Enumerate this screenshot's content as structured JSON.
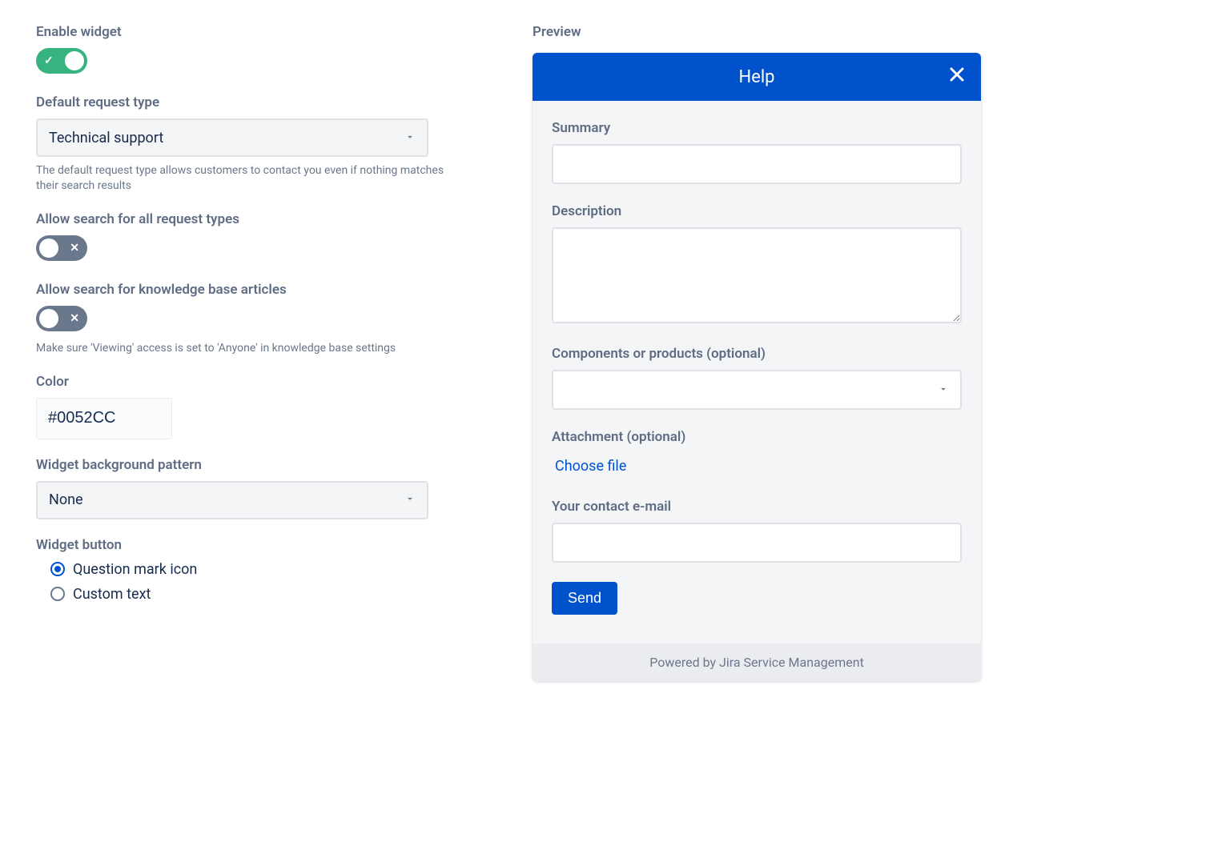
{
  "settings": {
    "enable_label": "Enable widget",
    "default_request": {
      "label": "Default request type",
      "value": "Technical support",
      "help": "The default request type allows customers to contact you even if nothing matches their search results"
    },
    "allow_search_types": {
      "label": "Allow search for all request types"
    },
    "allow_search_kb": {
      "label": "Allow search for knowledge base articles",
      "help": "Make sure 'Viewing' access is set to 'Anyone' in knowledge base settings"
    },
    "color": {
      "label": "Color",
      "value": "#0052CC"
    },
    "pattern": {
      "label": "Widget background pattern",
      "value": "None"
    },
    "widget_button": {
      "label": "Widget button",
      "option_icon": "Question mark icon",
      "option_text": "Custom text"
    }
  },
  "preview": {
    "label": "Preview",
    "title": "Help",
    "summary_label": "Summary",
    "description_label": "Description",
    "components_label": "Components or products (optional)",
    "attachment_label": "Attachment (optional)",
    "choose_file": "Choose file",
    "contact_label": "Your contact e-mail",
    "send": "Send",
    "footer": "Powered by Jira Service Management"
  },
  "colors": {
    "accent": "#0052CC"
  }
}
